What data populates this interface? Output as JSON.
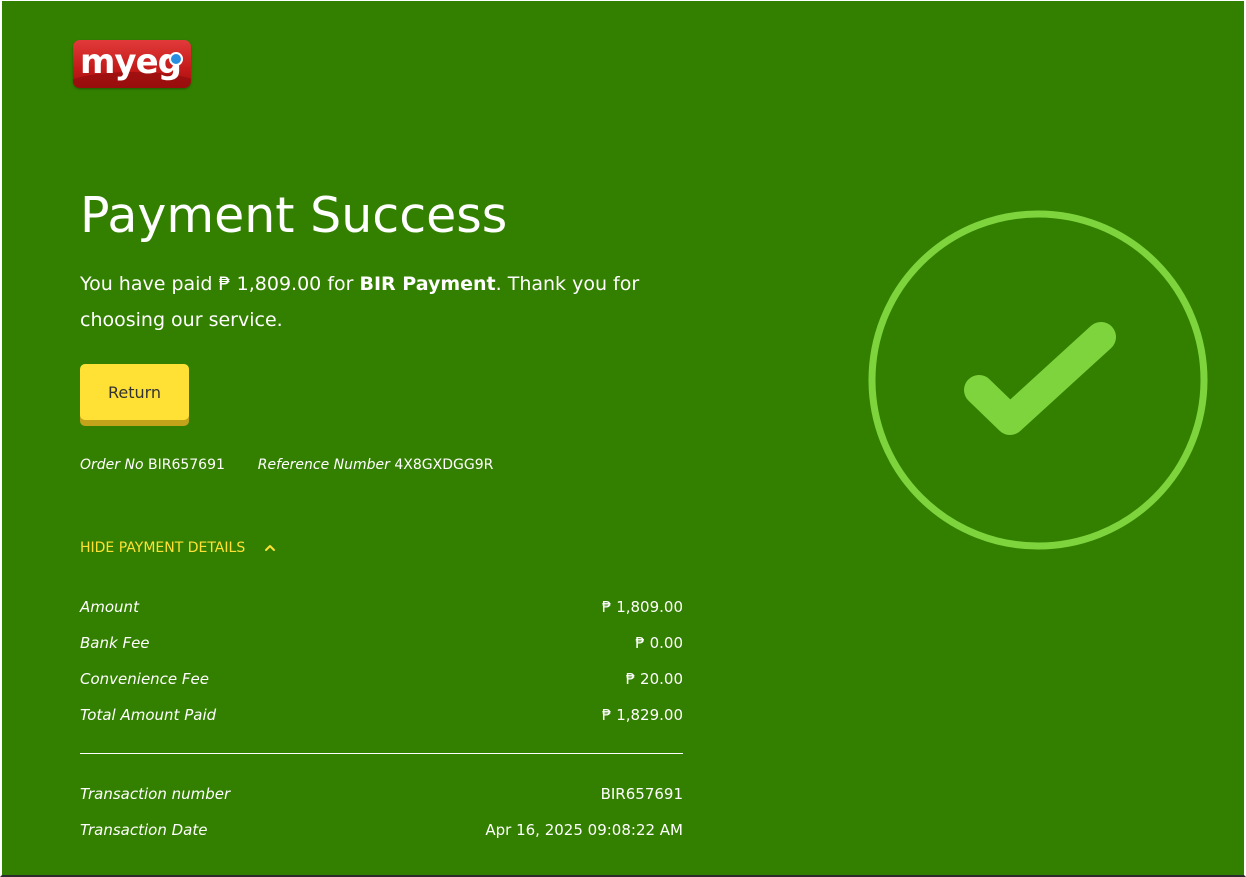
{
  "brand": {
    "logo_text": "myeg"
  },
  "title": "Payment Success",
  "message": {
    "prefix": "You have paid ",
    "amount": "₱ 1,809.00",
    "middle": " for ",
    "service": "BIR Payment",
    "suffix": ". Thank you for choosing our service."
  },
  "return_label": "Return",
  "order": {
    "label": "Order No",
    "value": "BIR657691"
  },
  "reference": {
    "label": "Reference Number",
    "value": "4X8GXDGG9R"
  },
  "toggle_label": "HIDE PAYMENT DETAILS",
  "fees": [
    {
      "label": "Amount",
      "value": "₱ 1,809.00"
    },
    {
      "label": "Bank Fee",
      "value": "₱ 0.00"
    },
    {
      "label": "Convenience Fee",
      "value": "₱ 20.00"
    },
    {
      "label": "Total Amount Paid",
      "value": "₱ 1,829.00"
    }
  ],
  "transaction": [
    {
      "label": "Transaction number",
      "value": "BIR657691"
    },
    {
      "label": "Transaction Date",
      "value": "Apr 16, 2025 09:08:22 AM"
    }
  ],
  "colors": {
    "background": "#338000",
    "accent": "#ffe135",
    "check": "#7ed43c",
    "logo": "#c41a1a"
  },
  "icons": {
    "success": "check-circle-icon",
    "toggle": "chevron-up-icon"
  }
}
